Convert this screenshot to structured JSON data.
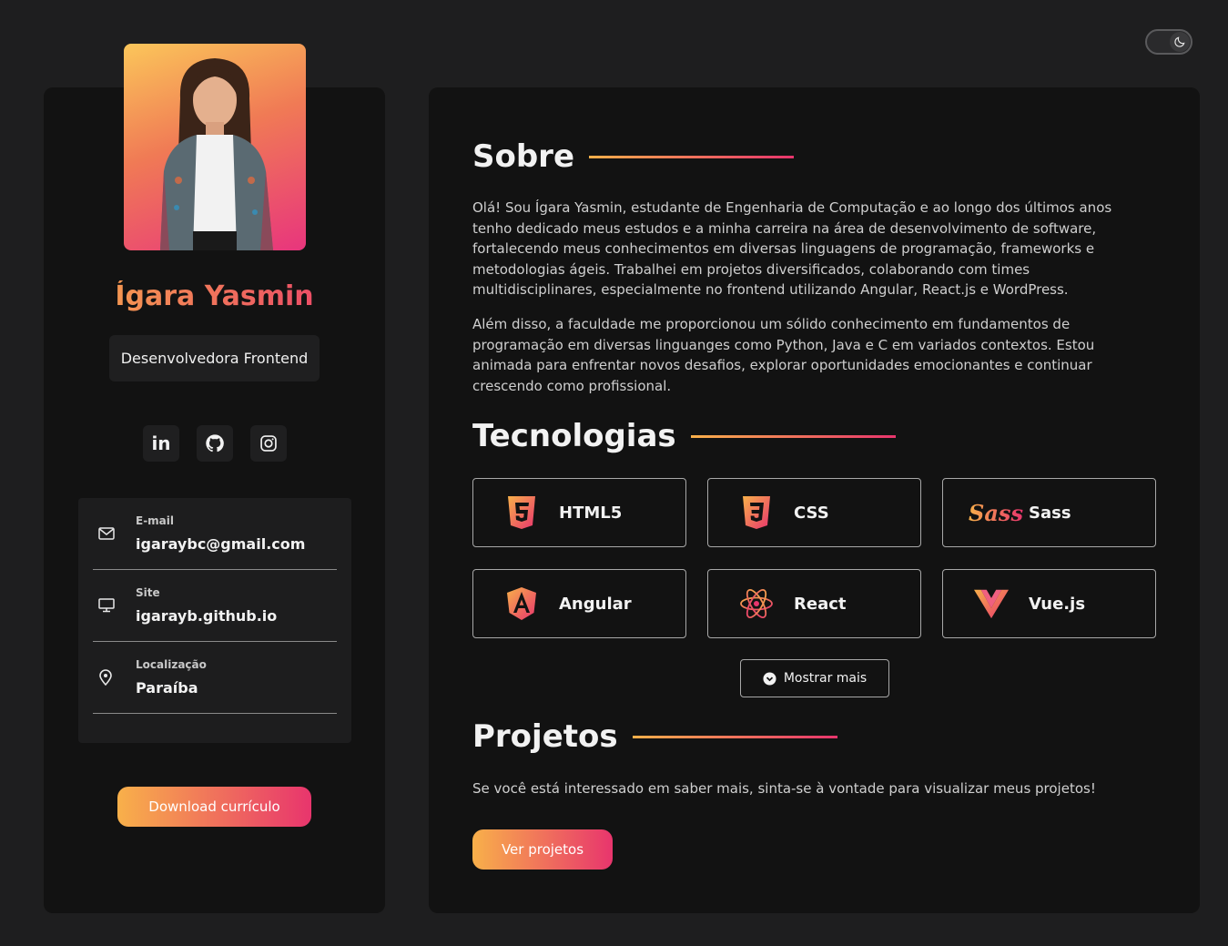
{
  "profile": {
    "first_name": "Ígara",
    "last_name": "Yasmin",
    "role": "Desenvolvedora Frontend"
  },
  "socials": [
    {
      "icon": "linkedin-icon"
    },
    {
      "icon": "github-icon"
    },
    {
      "icon": "instagram-icon"
    }
  ],
  "contacts": {
    "email": {
      "label": "E-mail",
      "value": "igaraybc@gmail.com",
      "icon": "mail-icon"
    },
    "site": {
      "label": "Site",
      "value": "igarayb.github.io",
      "icon": "monitor-icon"
    },
    "location": {
      "label": "Localização",
      "value": "Paraíba",
      "icon": "map-pin-icon"
    }
  },
  "download_label": "Download currículo",
  "about": {
    "title": "Sobre",
    "p1": "Olá! Sou Ígara Yasmin, estudante de Engenharia de Computação e ao longo dos últimos anos tenho dedicado meus estudos e a minha carreira na área de desenvolvimento de software, fortalecendo meus conhecimentos em diversas linguagens de programação, frameworks e metodologias ágeis. Trabalhei em projetos diversificados, colaborando com times multidisciplinares, especialmente no frontend utilizando Angular, React.js e WordPress.",
    "p2": "Além disso, a faculdade me proporcionou um sólido conhecimento em fundamentos de programação em diversas linguanges como Python, Java e C em variados contextos. Estou animada para enfrentar novos desafios, explorar oportunidades emocionantes e continuar crescendo como profissional."
  },
  "tech": {
    "title": "Tecnologias",
    "items": [
      {
        "name": "HTML5",
        "icon": "html5-icon"
      },
      {
        "name": "CSS",
        "icon": "css3-icon"
      },
      {
        "name": "Sass",
        "icon": "sass-icon"
      },
      {
        "name": "Angular",
        "icon": "angular-icon"
      },
      {
        "name": "React",
        "icon": "react-icon"
      },
      {
        "name": "Vue.js",
        "icon": "vue-icon"
      }
    ],
    "more_label": "Mostrar mais"
  },
  "projects": {
    "title": "Projetos",
    "text": "Se você está interessado em saber mais, sinta-se à vontade para visualizar meus projetos!",
    "button": "Ver projetos"
  },
  "colors": {
    "gradient_start": "#f8b04a",
    "gradient_end": "#e8356d",
    "background": "#1e1e1f",
    "panel": "#121212"
  }
}
